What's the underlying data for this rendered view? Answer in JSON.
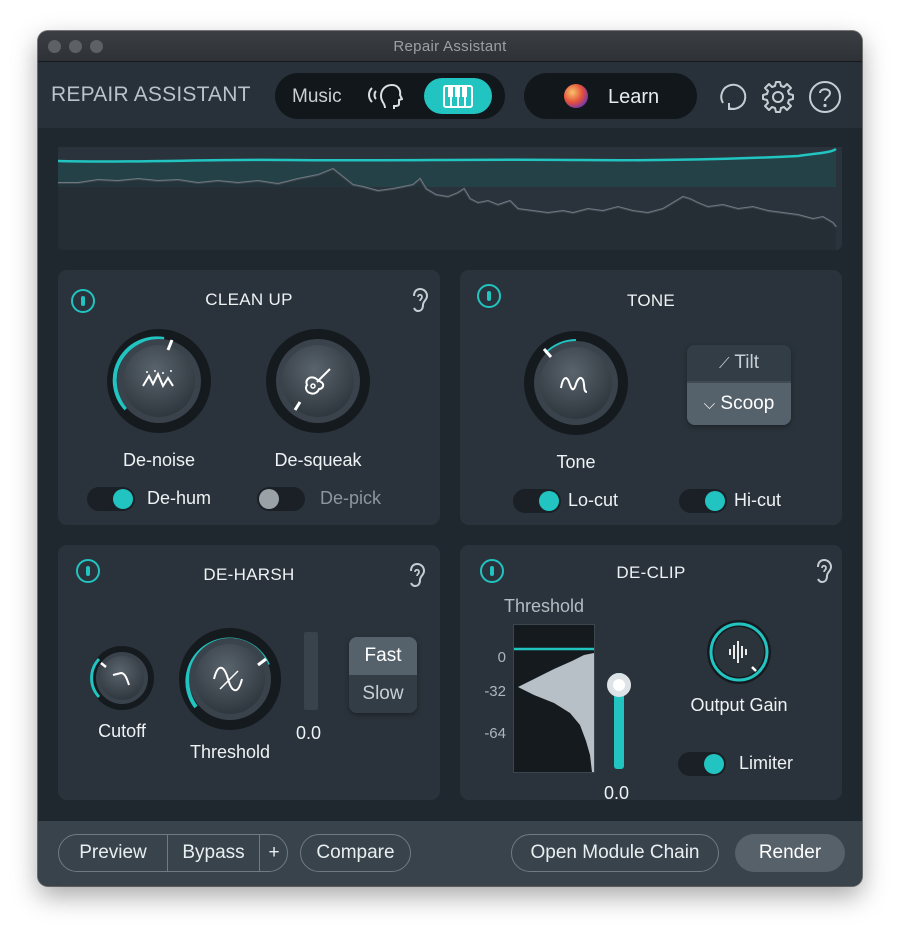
{
  "window": {
    "title": "Repair Assistant"
  },
  "header": {
    "app_title": "REPAIR ASSISTANT",
    "mode_music_label": "Music",
    "learn_label": "Learn"
  },
  "modules": {
    "clean_up": {
      "title": "CLEAN UP",
      "denoise_label": "De-noise",
      "desqueak_label": "De-squeak",
      "dehum_label": "De-hum",
      "dehum_on": true,
      "depick_label": "De-pick",
      "depick_on": false
    },
    "tone": {
      "title": "TONE",
      "tone_label": "Tone",
      "tilt_label": "Tilt",
      "scoop_label": "Scoop",
      "selected": "Scoop",
      "locut_label": "Lo-cut",
      "hicut_label": "Hi-cut"
    },
    "de_harsh": {
      "title": "DE-HARSH",
      "cutoff_label": "Cutoff",
      "threshold_label": "Threshold",
      "meter_value": "0.0",
      "fast_label": "Fast",
      "slow_label": "Slow",
      "selected": "Fast"
    },
    "de_clip": {
      "title": "DE-CLIP",
      "threshold_label": "Threshold",
      "axis_labels": [
        "0",
        "-32",
        "-64"
      ],
      "threshold_value": "0.0",
      "output_gain_label": "Output Gain",
      "limiter_label": "Limiter",
      "limiter_on": true
    }
  },
  "footer": {
    "preview_label": "Preview",
    "bypass_label": "Bypass",
    "plus_label": "+",
    "compare_label": "Compare",
    "open_chain_label": "Open Module Chain",
    "render_label": "Render"
  },
  "colors": {
    "accent": "#21c4c0",
    "panel": "#2a333b",
    "background": "#20282f",
    "footer": "#38434b"
  },
  "icons": [
    "speech-icon",
    "piano-icon",
    "learn-orb-icon",
    "history-icon",
    "gear-icon",
    "help-icon",
    "power-icon",
    "ear-icon",
    "guitar-icon",
    "noise-icon"
  ]
}
